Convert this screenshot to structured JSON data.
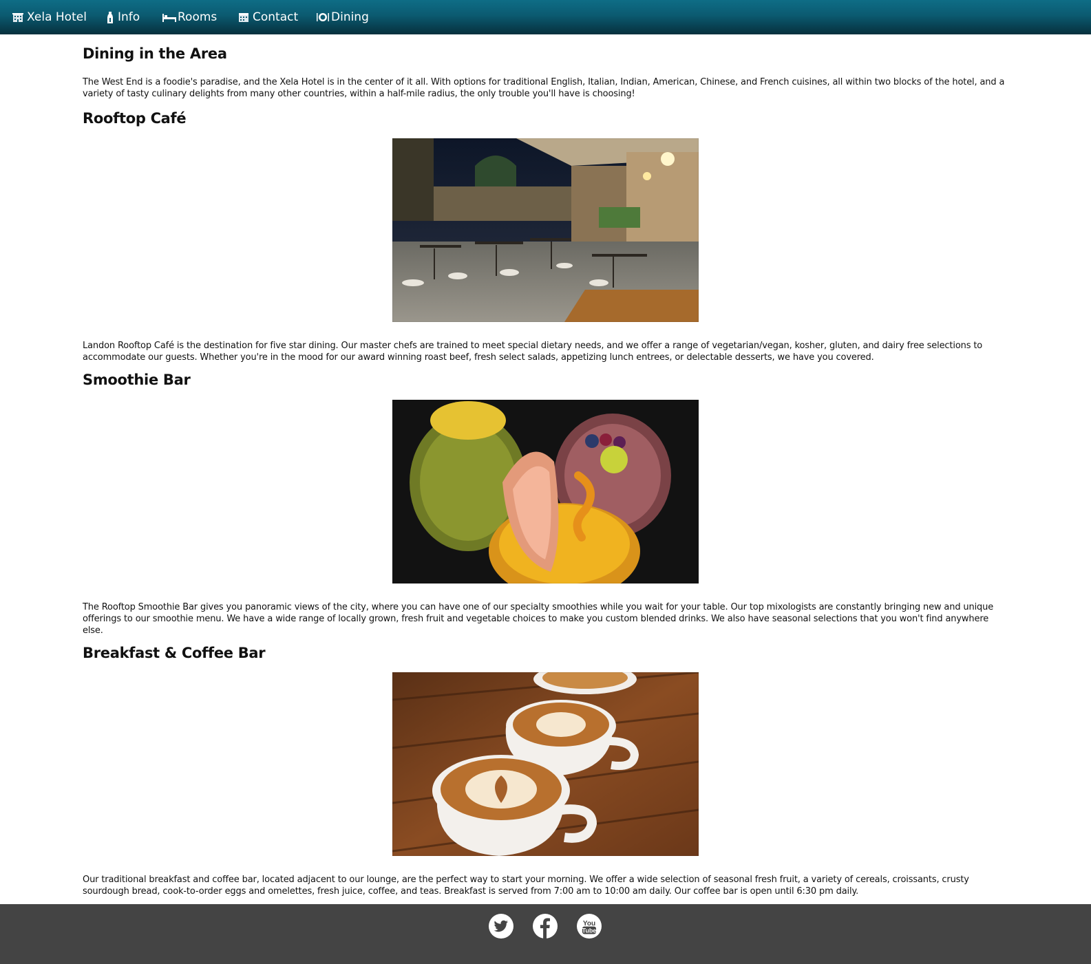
{
  "nav": {
    "brand": {
      "label": "Xela Hotel",
      "icon": "hotel-icon"
    },
    "items": [
      {
        "label": "Info",
        "icon": "info-bottle-icon"
      },
      {
        "label": "Rooms",
        "icon": "bed-icon"
      },
      {
        "label": "Contact",
        "icon": "calendar-icon"
      },
      {
        "label": "Dining",
        "icon": "plate-icon"
      }
    ]
  },
  "main": {
    "title": "Dining in the Area",
    "intro": "The West End is a foodie's paradise, and the Xela Hotel is in the center of it all. With options for traditional English, Italian, Indian, American, Chinese, and French cuisines, all within two blocks of the hotel, and a variety of tasty culinary delights from many other countries, within a half-mile radius, the only trouble you'll have is choosing!",
    "sections": [
      {
        "heading": "Rooftop Café",
        "text": "Landon Rooftop Café is the destination for five star dining. Our master chefs are trained to meet special dietary needs, and we offer a range of vegetarian/vegan, kosher, gluten, and dairy free selections to accommodate our guests. Whether you're in the mood for our award winning roast beef, fresh select salads, appetizing lunch entrees, or delectable desserts, we have you covered."
      },
      {
        "heading": "Smoothie Bar",
        "text": "The Rooftop Smoothie Bar gives you panoramic views of the city, where you can have one of our specialty smoothies while you wait for your table. Our top mixologists are constantly bringing new and unique offerings to our smoothie menu. We have a wide range of locally grown, fresh fruit and vegetable choices to make you custom blended drinks. We also have seasonal selections that you won't find anywhere else."
      },
      {
        "heading": "Breakfast & Coffee Bar",
        "text": "Our traditional breakfast and coffee bar, located adjacent to our lounge, are the perfect way to start your morning. We offer a wide selection of seasonal fresh fruit, a variety of cereals, croissants, crusty sourdough bread, cook-to-order eggs and omelettes, fresh juice, coffee, and teas. Breakfast is served from 7:00 am to 10:00 am daily. Our coffee bar is open until 6:30 pm daily."
      }
    ]
  },
  "footer": {
    "social": [
      {
        "icon": "twitter-icon"
      },
      {
        "icon": "facebook-icon"
      },
      {
        "icon": "youtube-icon",
        "label_top": "You",
        "label_bottom": "Tube"
      }
    ]
  },
  "colors": {
    "nav_bg_top": "#0e6d86",
    "nav_bg_bottom": "#06303d",
    "footer_bg": "#444444",
    "text": "#111111"
  }
}
